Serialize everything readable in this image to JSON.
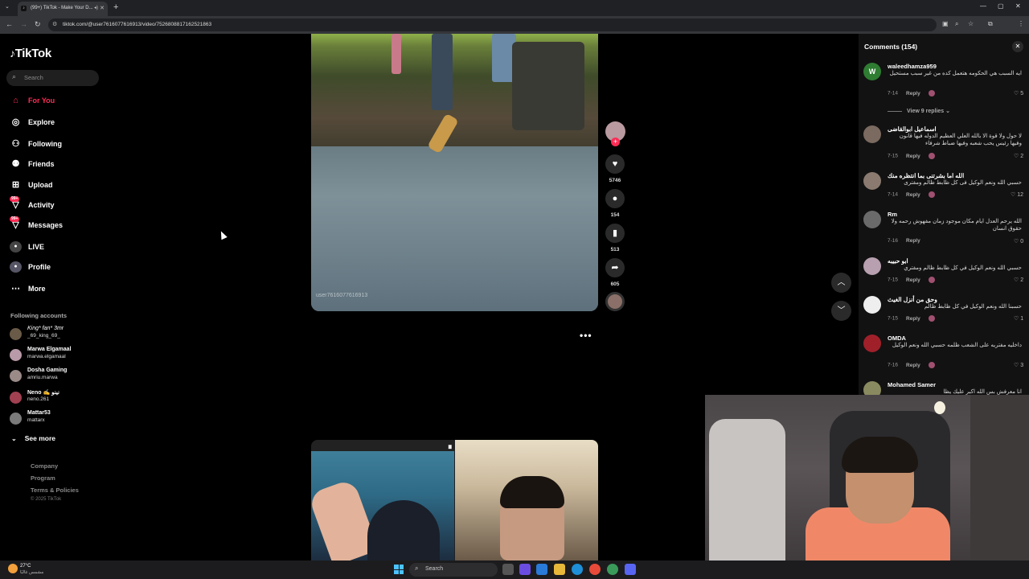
{
  "browser": {
    "tab_title": "(99+) TikTok - Make Your D...",
    "url": "tiktok.com/@user7616077616913/video/7526808817162521863"
  },
  "sidebar": {
    "logo": "TikTok",
    "search_placeholder": "Search",
    "nav": [
      {
        "label": "For You",
        "icon": "home-icon"
      },
      {
        "label": "Explore",
        "icon": "compass-icon"
      },
      {
        "label": "Following",
        "icon": "person-plus-icon"
      },
      {
        "label": "Friends",
        "icon": "friends-icon"
      },
      {
        "label": "Upload",
        "icon": "plus-square-icon"
      },
      {
        "label": "Activity",
        "icon": "bell-icon",
        "badge": "99+"
      },
      {
        "label": "Messages",
        "icon": "message-icon",
        "badge": "99+"
      },
      {
        "label": "LIVE",
        "icon": "live-icon"
      },
      {
        "label": "Profile",
        "icon": "avatar-icon"
      },
      {
        "label": "More",
        "icon": "more-dots-icon"
      }
    ],
    "following_title": "Following accounts",
    "accounts": [
      {
        "name": "King* fan* 3mr",
        "handle": "_69_king_69_"
      },
      {
        "name": "Marwa Elgamaal",
        "handle": "marwa.elgamaal"
      },
      {
        "name": "Dosha Gaming",
        "handle": "amriu.marwa"
      },
      {
        "name": "Neno ✍ نينو",
        "handle": "neno.261"
      },
      {
        "name": "Mattar53",
        "handle": "mattarx"
      }
    ],
    "see_more": "See more",
    "footer": [
      "Company",
      "Program",
      "Terms & Policies"
    ],
    "copyright": "© 2025 TikTok"
  },
  "video": {
    "watermark": "user7616077616913",
    "likes": "5746",
    "comments": "154",
    "saves": "513",
    "shares": "605"
  },
  "comments_panel": {
    "title": "Comments (154)",
    "view_replies": "View 9 replies",
    "items": [
      {
        "user": "waleedhamza959",
        "text": "ايه السبب هي الحكومه هتعمل كده من غير سبب مستحيل",
        "date": "7-14",
        "reply": "Reply",
        "likes": "5",
        "avatar": "W"
      },
      {
        "user": "اسماعيل ابوالقاضى",
        "text": "لا حول ولا قوة الا بالله العلي العظيم الدوله فيها قانون وفيها رئيس يحب شعبه وفيها ضباط شرفاء",
        "date": "7-15",
        "reply": "Reply",
        "likes": "2",
        "avatar": ""
      },
      {
        "user": "الله اما بشرتنى بما انتظره منك",
        "text": "حسبي الله ونعم الوكيل فى كل ظابط ظالم ومفترى",
        "date": "7-14",
        "reply": "Reply",
        "likes": "12",
        "avatar": ""
      },
      {
        "user": "Rm",
        "text": "الله يرحم العدل ايام مكان موجود زمان مفهوش رحمه ولا حقوق انسان",
        "date": "7-16",
        "reply": "Reply",
        "likes": "0",
        "avatar": ""
      },
      {
        "user": "ابو حبيبه",
        "text": "حسبي الله ونعم الوكيل في كل ظابط ظالم ومفتري",
        "date": "7-15",
        "reply": "Reply",
        "likes": "2",
        "avatar": ""
      },
      {
        "user": "وحق من أنزل الغيث",
        "text": "حسبنا الله ونعم الوكيل في كل ظابط ظالم",
        "date": "7-15",
        "reply": "Reply",
        "likes": "1",
        "avatar": ""
      },
      {
        "user": "OMDA",
        "text": "داخليه مفتريه على الشعب ظلمه حسبي الله ونعم الوكيل",
        "date": "7-16",
        "reply": "Reply",
        "likes": "3",
        "avatar": ""
      },
      {
        "user": "Mohamed Samer",
        "text": "انا معرفش بس الله اكبر عليك يظا",
        "date": "",
        "reply": "",
        "likes": "",
        "avatar": ""
      }
    ]
  },
  "taskbar": {
    "weather_temp": "27°C",
    "weather_desc": "مشمس غالبًا",
    "search": "Search"
  },
  "colors": {
    "accent": "#fe2c55",
    "background": "#000000",
    "panel": "#121212"
  }
}
